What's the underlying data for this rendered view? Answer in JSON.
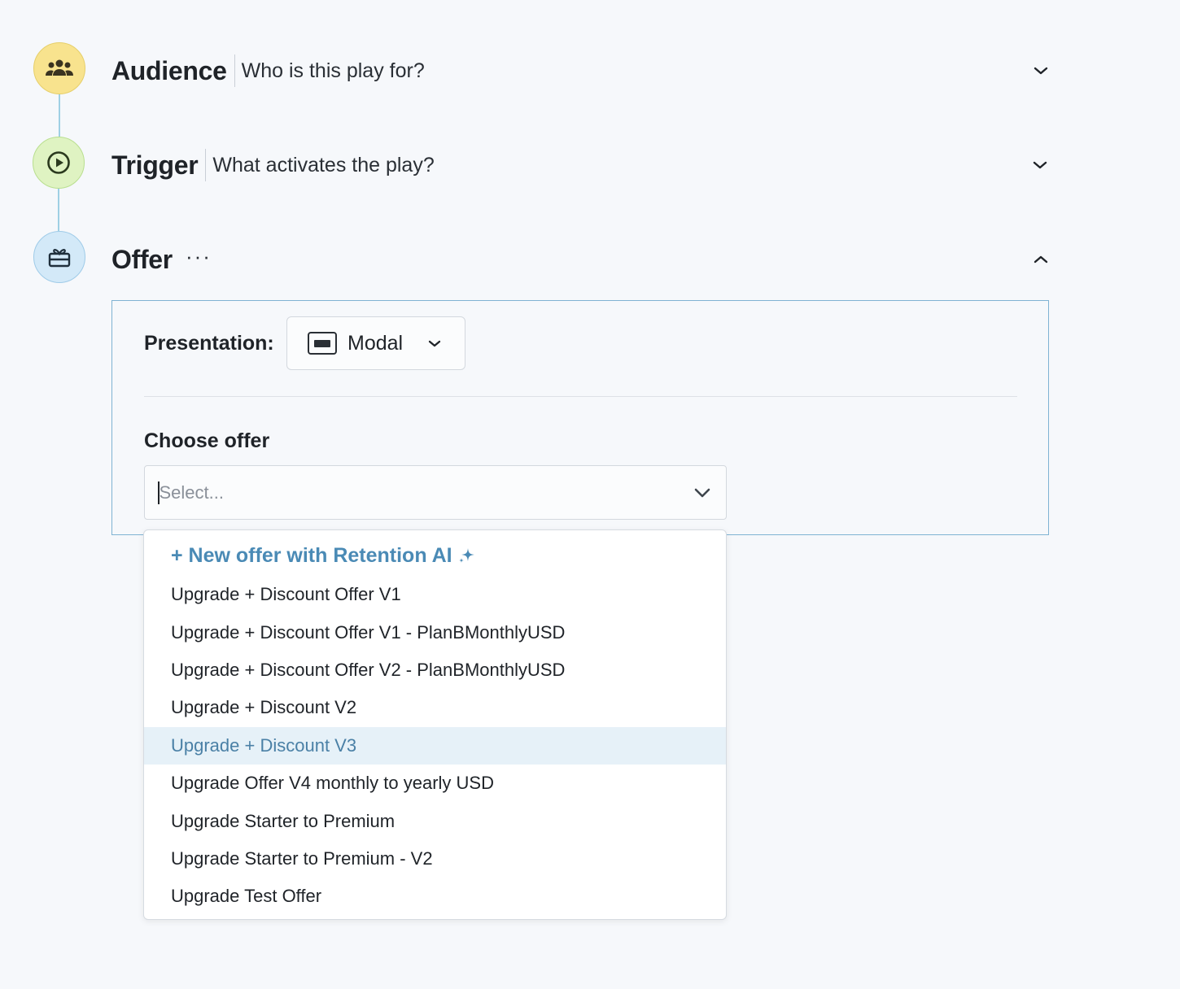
{
  "steps": {
    "audience": {
      "title": "Audience",
      "description": "Who is this play for?",
      "icon": "people-group-icon",
      "color": "#f8e38e"
    },
    "trigger": {
      "title": "Trigger",
      "description": "What activates the play?",
      "icon": "play-circle-icon",
      "color": "#dff3c2"
    },
    "offer": {
      "title": "Offer",
      "more": "···",
      "icon": "gift-card-icon",
      "color": "#d3e9f8"
    }
  },
  "offer_panel": {
    "presentation_label": "Presentation:",
    "presentation_value": "Modal",
    "choose_label": "Choose offer",
    "select_placeholder": "Select..."
  },
  "dropdown": {
    "new_offer_label": "+ New offer with Retention AI",
    "items": [
      "Upgrade + Discount Offer V1",
      "Upgrade + Discount Offer V1 - PlanBMonthlyUSD",
      "Upgrade + Discount Offer V2 - PlanBMonthlyUSD",
      "Upgrade + Discount V2",
      "Upgrade + Discount V3",
      "Upgrade Offer V4 monthly to yearly USD",
      "Upgrade Starter to Premium",
      "Upgrade Starter to Premium - V2",
      "Upgrade Test Offer"
    ],
    "highlighted_index": 4,
    "accent_color": "#4a8ab5"
  }
}
